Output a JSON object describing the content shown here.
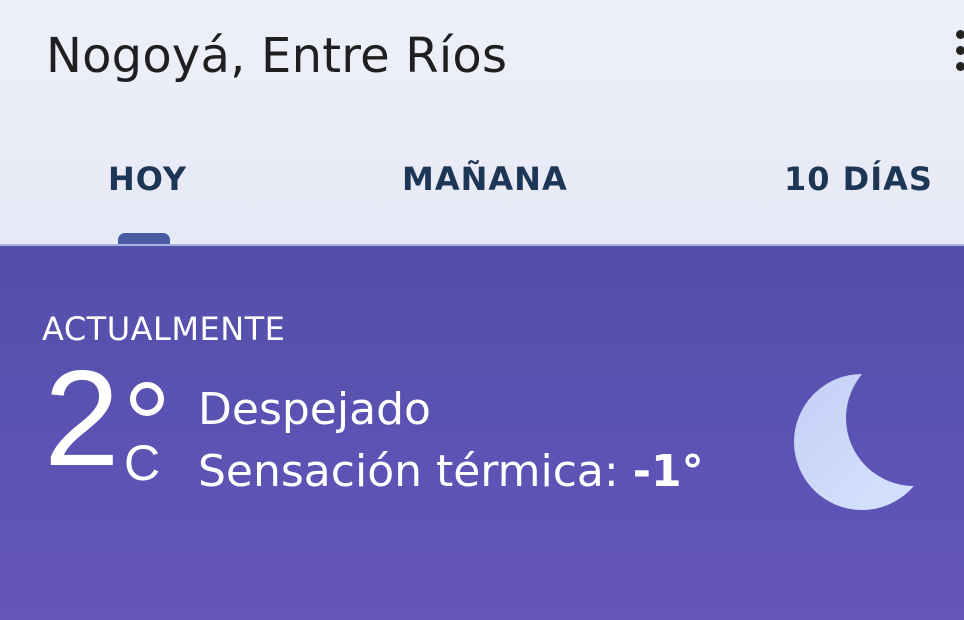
{
  "header": {
    "location": "Nogoyá, Entre Ríos"
  },
  "tabs": [
    {
      "label": "HOY",
      "selected": true
    },
    {
      "label": "MAÑANA",
      "selected": false
    },
    {
      "label": "10 DÍAS",
      "selected": false
    }
  ],
  "current": {
    "heading": "ACTUALMENTE",
    "temperature": "2",
    "unit": "C",
    "condition": "Despejado",
    "feels_like_label": "Sensación térmica:",
    "feels_like_value": "-1°",
    "condition_icon": "moon-icon"
  },
  "colors": {
    "header_bg": "#eef0f8",
    "panel_bg": "#5b4fb0",
    "tab_text": "#1e3655",
    "moon": "#c8d6fb"
  }
}
